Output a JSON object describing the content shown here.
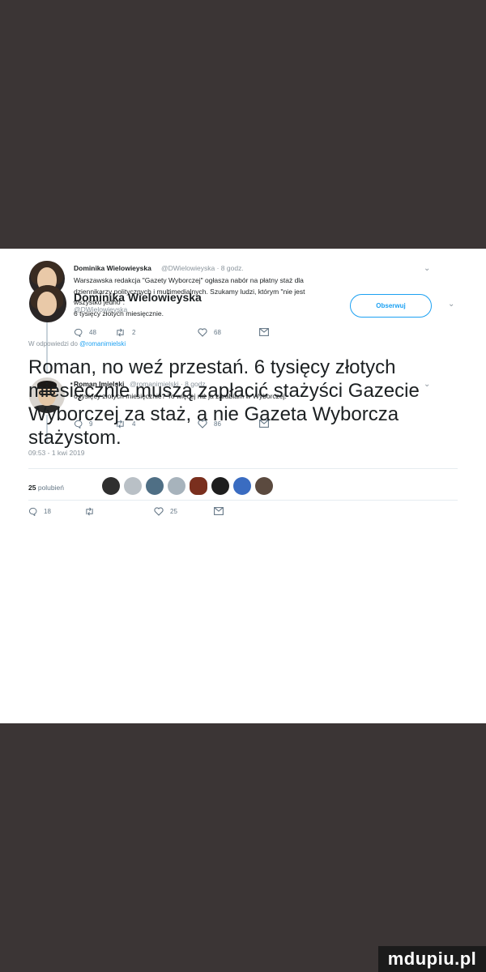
{
  "tweet1": {
    "name": "Dominika Wielowieyska",
    "handle_time": "@DWielowieyska · 8 godz.",
    "text_lines": [
      "Warszawska redakcja \"Gazety Wyborczej\" ogłasza nabór na płatny staż dla",
      "dziennikarzy politycznych i multimedialnych. Szukamy ludzi, którym \"nie jest",
      "wszystko jedno\".",
      "6 tysięcy złotych miesięcznie."
    ],
    "replies": "48",
    "retweets": "2",
    "likes": "68"
  },
  "tweet2": {
    "name": "Roman Imielski",
    "handle_time": "@romanimielski · 8 godz.",
    "text": "6 tysięcy złotych miesięcznie? To więcej niż ja zarabiam w Wyborczej.",
    "replies": "9",
    "retweets": "4",
    "likes": "86"
  },
  "main_tweet": {
    "name": "Dominika Wielowieyska",
    "handle": "@DWielowieyska",
    "follow_label": "Obserwuj",
    "reply_prefix": "W odpowiedzi do",
    "reply_mention": "@romanimielski",
    "text": "Roman, no weź przestań. 6 tysięcy złotych miesięcznie muszą zapłacić stażyści Gazecie Wyborczej za staż, a nie Gazeta Wyborcza stażystom.",
    "timestamp": "09:53 - 1 kwi 2019",
    "likes_number": "25",
    "likes_label": "polubień",
    "replies": "18",
    "retweets": "",
    "likes": "25"
  },
  "icons": {
    "reply": "reply-icon",
    "retweet": "retweet-icon",
    "like": "heart-icon",
    "dm": "message-icon",
    "more": "chevron-down-icon"
  },
  "colors": {
    "accent": "#1da1f2",
    "text": "#1c2022",
    "muted": "#8a949c",
    "background": "#3b3535"
  },
  "watermark": "mdupiu.pl"
}
